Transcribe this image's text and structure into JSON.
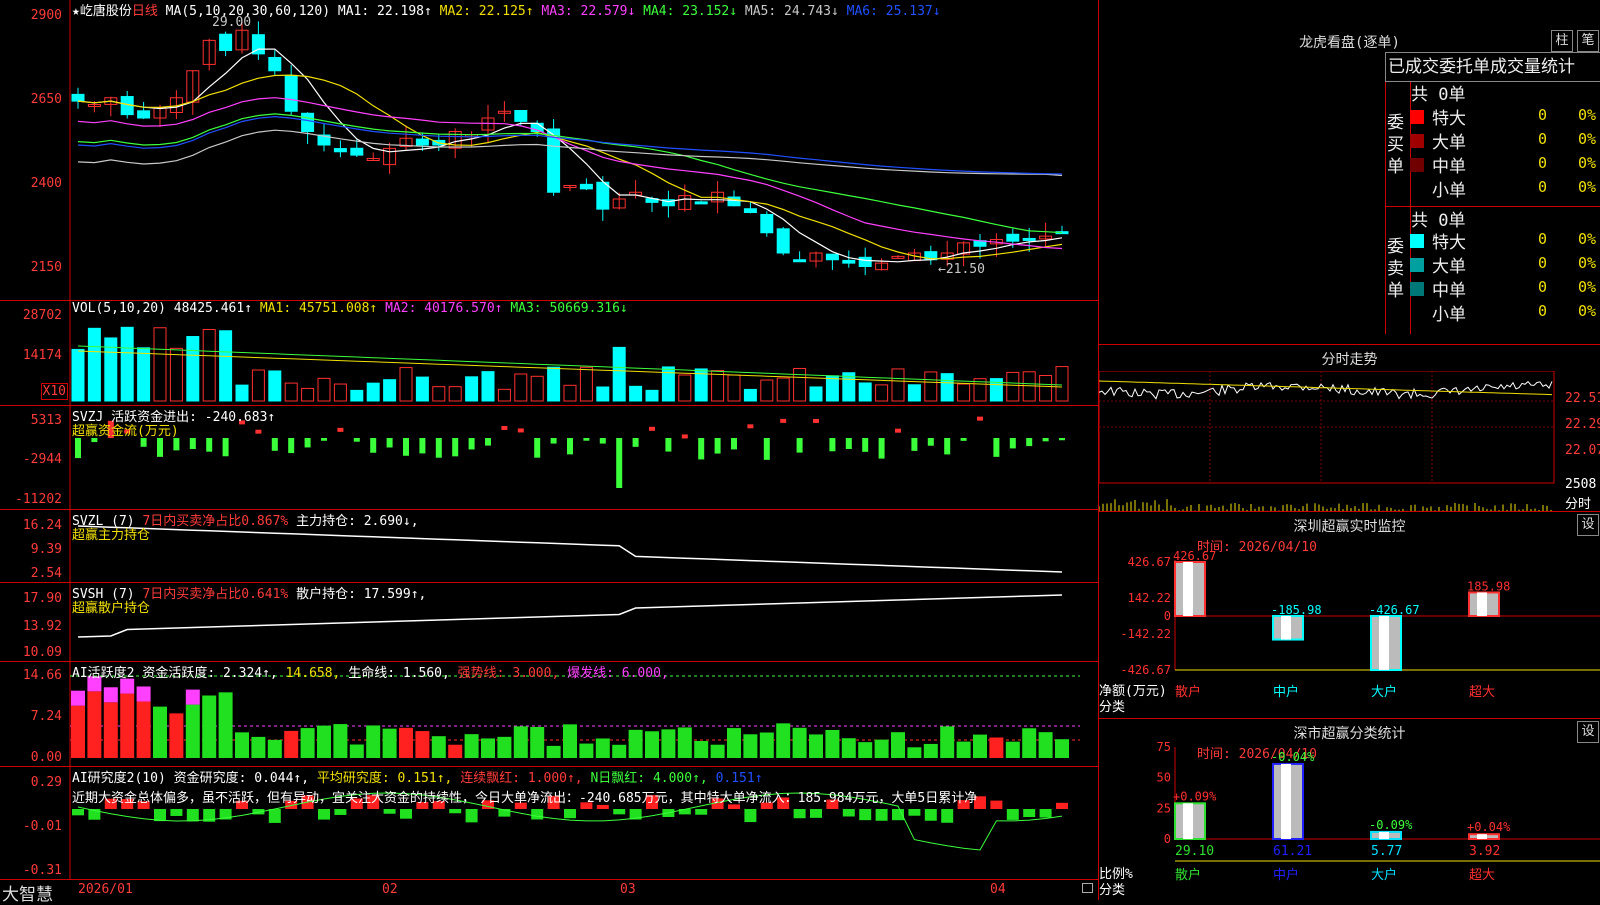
{
  "stock": {
    "name": "★屹唐股份",
    "period": "日线",
    "ma_label": "MA(5,10,20,30,60,120)",
    "ma": [
      {
        "label": "MA1: 22.198↑",
        "color": "#ffffff"
      },
      {
        "label": "MA2: 22.125↑",
        "color": "#f0e000"
      },
      {
        "label": "MA3: 22.579↓",
        "color": "#ff40ff"
      },
      {
        "label": "MA4: 23.152↓",
        "color": "#3cff3c"
      },
      {
        "label": "MA5: 24.743↓",
        "color": "#c8c8c8"
      },
      {
        "label": "MA6: 25.137↓",
        "color": "#2050ff"
      }
    ],
    "high_mark": "29.00",
    "low_mark": "←21.50",
    "price_axis": [
      "2900",
      "2650",
      "2400",
      "2150"
    ]
  },
  "vol": {
    "header": "VOL(5,10,20)",
    "value": "48425.461↑",
    "ma1": "MA1: 45751.008↑",
    "ma2": "MA2: 40176.570↑",
    "ma3": "MA3: 50669.316↓",
    "axis": [
      "28702",
      "14174"
    ],
    "unit": "X10"
  },
  "svzj": {
    "header": "SVZJ  活跃资金进出: -240.683↑",
    "title": "超赢资金流(万元)",
    "axis": [
      "5313",
      "-2944",
      "-11202"
    ]
  },
  "svzl": {
    "header": "SVZL (7)",
    "sub": "7日内买卖净占比0.867%",
    "main": "主力持仓: 2.690↓,",
    "title": "超赢主力持仓",
    "axis": [
      "16.24",
      "9.39",
      "2.54"
    ]
  },
  "svsh": {
    "header": "SVSH (7)",
    "sub": "7日内买卖净占比0.641%",
    "main": "散户持仓: 17.599↑,",
    "title": "超赢散户持仓",
    "axis": [
      "17.90",
      "13.92",
      "10.09"
    ]
  },
  "ai1": {
    "header": "AI活跃度2",
    "v1": "资金活跃度: 2.324↑,",
    "v2": "14.658,",
    "v3": "生命线: 1.560,",
    "v4": "强势线: 3.000,",
    "v5": "爆发线: 6.000,",
    "axis": [
      "14.66",
      "7.24",
      "0.00"
    ]
  },
  "ai2": {
    "header": "AI研究度2(10)",
    "v1": "资金研究度: 0.044↑,",
    "v2": "平均研究度: 0.151↑,",
    "v3": "连续飘红: 1.000↑,",
    "v4": "N日飘红: 4.000↑,",
    "v5": "0.151↑",
    "text": "近期大资金总体偏多，虽不活跃，但有异动，宜关注大资金的持续性，今日大单净流出：-240.685万元，其中特大单净流入：185.984万元，大单5日累计净",
    "axis": [
      "0.29",
      "-0.01",
      "-0.31"
    ]
  },
  "xaxis": {
    "labels": [
      "2026/01",
      "02",
      "03",
      "04"
    ]
  },
  "brand": "大智慧",
  "lhb": {
    "title": "龙虎看盘(逐单)",
    "btn_zhu": "柱",
    "btn_bi": "笔",
    "tabs": "已成交委托单成交量统计",
    "buy": {
      "side": "委买单",
      "total": "共 0单",
      "rows": [
        {
          "label": "特大",
          "cnt": "0",
          "pct": "0%",
          "color": "#ff0000"
        },
        {
          "label": "大单",
          "cnt": "0",
          "pct": "0%",
          "color": "#a00000"
        },
        {
          "label": "中单",
          "cnt": "0",
          "pct": "0%",
          "color": "#700000"
        },
        {
          "label": "小单",
          "cnt": "0",
          "pct": "0%",
          "color": "#000000"
        }
      ]
    },
    "sell": {
      "side": "委卖单",
      "total": "共 0单",
      "rows": [
        {
          "label": "特大",
          "cnt": "0",
          "pct": "0%",
          "color": "#00ffff"
        },
        {
          "label": "大单",
          "cnt": "0",
          "pct": "0%",
          "color": "#00a0a0"
        },
        {
          "label": "中单",
          "cnt": "0",
          "pct": "0%",
          "color": "#007878"
        },
        {
          "label": "小单",
          "cnt": "0",
          "pct": "0%",
          "color": "#000000"
        }
      ]
    }
  },
  "intraday": {
    "title": "分时走势",
    "axis": [
      "22.51",
      "22.29",
      "22.07",
      "2508"
    ],
    "unit": "分时"
  },
  "monitor": {
    "title": "深圳超赢实时监控",
    "set": "设",
    "time": "时间: 2026/04/10",
    "ylabel": "净额(万元)",
    "xlabel": "分类",
    "axis": [
      "426.67",
      "142.22",
      "0",
      "-142.22",
      "-426.67"
    ],
    "bars": [
      {
        "cat": "散户",
        "value": 426.67,
        "label": "426.67"
      },
      {
        "cat": "中户",
        "value": -185.98,
        "label": "-185.98"
      },
      {
        "cat": "大户",
        "value": -426.67,
        "label": "-426.67"
      },
      {
        "cat": "超大",
        "value": 185.98,
        "label": "185.98"
      }
    ]
  },
  "classify": {
    "title": "深市超赢分类统计",
    "set": "设",
    "time": "时间: 2026/04/10",
    "ylabel": "比例%",
    "xlabel": "分类",
    "axis": [
      "75",
      "50",
      "25",
      "0"
    ],
    "bars": [
      {
        "cat": "散户",
        "value": 29.1,
        "label": "29.10",
        "chg": "+0.09%",
        "color": "#30e030"
      },
      {
        "cat": "中户",
        "value": 61.21,
        "label": "61.21",
        "chg": "-0.04%",
        "color": "#2020ff"
      },
      {
        "cat": "大户",
        "value": 5.77,
        "label": "5.77",
        "chg": "-0.09%",
        "color": "#00e0ff"
      },
      {
        "cat": "超大",
        "value": 3.92,
        "label": "3.92",
        "chg": "+0.04%",
        "color": "#ff3030"
      }
    ]
  },
  "chart_data": {
    "type": "table",
    "categories": [
      "散户",
      "中户",
      "大户",
      "超大"
    ],
    "series": [
      {
        "name": "净额(万元)",
        "values": [
          426.67,
          -185.98,
          -426.67,
          185.98
        ]
      },
      {
        "name": "比例%",
        "values": [
          29.1,
          61.21,
          5.77,
          3.92
        ]
      }
    ]
  }
}
